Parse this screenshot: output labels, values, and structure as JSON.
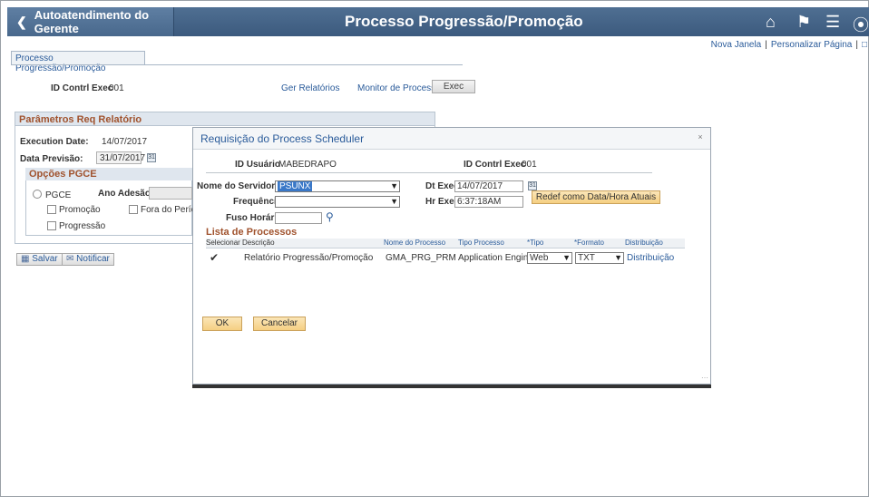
{
  "header": {
    "back_label": "Autoatendimento do Gerente",
    "title": "Processo Progressão/Promoção",
    "icons": [
      "home-icon",
      "flag-icon",
      "menu-icon",
      "navbar-icon"
    ]
  },
  "sublinks": {
    "new_window": "Nova Janela",
    "personalize": "Personalizar Página"
  },
  "page": {
    "tab_label": "Processo Progressão/Promoção",
    "run_control_label": "ID Contrl Exec",
    "run_control_value": "001",
    "report_manager": "Ger Relatórios",
    "process_monitor": "Monitor de Processos",
    "exec_button": "Exec",
    "params_header": "Parâmetros Req Relatório",
    "execution_date_label": "Execution Date:",
    "execution_date_value": "14/07/2017",
    "forecast_date_label": "Data Previsão:",
    "forecast_date_value": "31/07/2017",
    "pgce_header": "Opções PGCE",
    "pgce_label": "PGCE",
    "year_label": "Ano Adesão:",
    "promotion_label": "Promoção",
    "out_of_period_label": "Fora do Períod",
    "progression_label": "Progressão",
    "save_button": "Salvar",
    "notify_button": "Notificar"
  },
  "modal": {
    "title": "Requisição do Process Scheduler",
    "user_id_label": "ID Usuário",
    "user_id_value": "MABEDRAPO",
    "run_control_label": "ID Contrl Exec",
    "run_control_value": "001",
    "server_label": "Nome do Servidor",
    "server_value": "PSUNX",
    "run_date_label": "Dt Exec",
    "run_date_value": "14/07/2017",
    "recurrence_label": "Frequência",
    "recurrence_value": "",
    "run_time_label": "Hr Exec",
    "run_time_value": "6:37:18AM",
    "reset_button": "Redef como Data/Hora Atuais",
    "timezone_label": "Fuso Horário",
    "timezone_value": "",
    "process_list_header": "Lista de Processos",
    "columns": [
      "Selecionar",
      "Descrição",
      "Nome do Processo",
      "Tipo Processo",
      "*Tipo",
      "*Formato",
      "Distribuição"
    ],
    "row": {
      "selected": true,
      "description": "Relatório Progressão/Promoção",
      "process_name": "GMA_PRG_PRM",
      "process_type": "Application Engine",
      "type": "Web",
      "format": "TXT",
      "distribution": "Distribuição"
    },
    "ok_button": "OK",
    "cancel_button": "Cancelar"
  }
}
